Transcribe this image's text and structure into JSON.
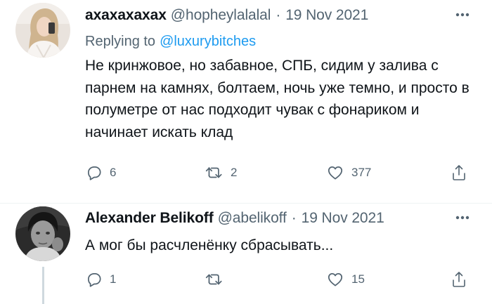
{
  "tweets": [
    {
      "name": "ахахахахах",
      "handle": "@hopheylalalal",
      "separator": "·",
      "date": "19 Nov 2021",
      "replying_label": "Replying to",
      "replying_to": "@luxurybitches",
      "text": "Не кринжовое, но забавное, СПБ, сидим у залива с парнем на камнях, болтаем, ночь уже темно, и просто в полуметре от нас подходит чувак с фонариком и начинает искать клад",
      "reply_count": "6",
      "retweet_count": "2",
      "like_count": "377"
    },
    {
      "name": "Alexander Belikoff",
      "handle": "@abelikoff",
      "separator": "·",
      "date": "19 Nov 2021",
      "text": "А мог бы расчленёнку сбрасывать...",
      "reply_count": "1",
      "retweet_count": "",
      "like_count": "15"
    }
  ],
  "colors": {
    "secondary_text": "#536471",
    "link": "#1d9bf0",
    "primary_text": "#0f1419",
    "divider": "#eff3f4"
  },
  "icons": [
    "more-icon",
    "reply-icon",
    "retweet-icon",
    "like-icon",
    "share-icon"
  ]
}
